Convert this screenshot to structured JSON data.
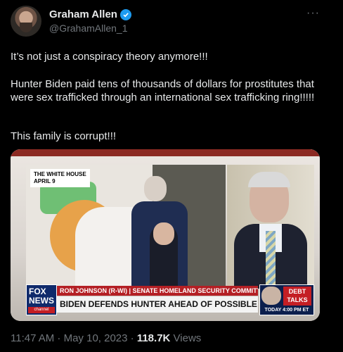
{
  "tweet": {
    "author_name": "Graham Allen",
    "author_handle": "@GrahamAllen_1",
    "more_label": "···",
    "text_line1": "It’s not just a conspiracy theory anymore!!!",
    "text_line2": "Hunter Biden paid tens of thousands of dollars for prostitutes that were sex trafficked through an international sex trafficking ring!!!!!",
    "text_line3": "This family is corrupt!!!",
    "timestamp": "11:47 AM · May 10, 2023 · ",
    "views_count": "118.7K",
    "views_label": " Views"
  },
  "media": {
    "location_label_line1": "THE WHITE HOUSE",
    "location_label_line2": "APRIL 9",
    "logo_line1": "FOX",
    "logo_line2": "NEWS",
    "logo_line3": "channel",
    "chyron_top": "RON JOHNSON (R-WI) | SENATE HOMELAND SECURITY COMMITTEE",
    "chyron_bottom": "BIDEN DEFENDS HUNTER AHEAD OF POSSIBLE CHARGES",
    "promo_title_line1": "DEBT",
    "promo_title_line2": "TALKS",
    "promo_time": "TODAY 4:00 PM ET"
  },
  "colors": {
    "background": "#000000",
    "text": "#e7e9ea",
    "muted": "#71767b",
    "verified": "#1d9bf0",
    "fox_red": "#c41e24",
    "fox_blue": "#0f2a6b"
  }
}
